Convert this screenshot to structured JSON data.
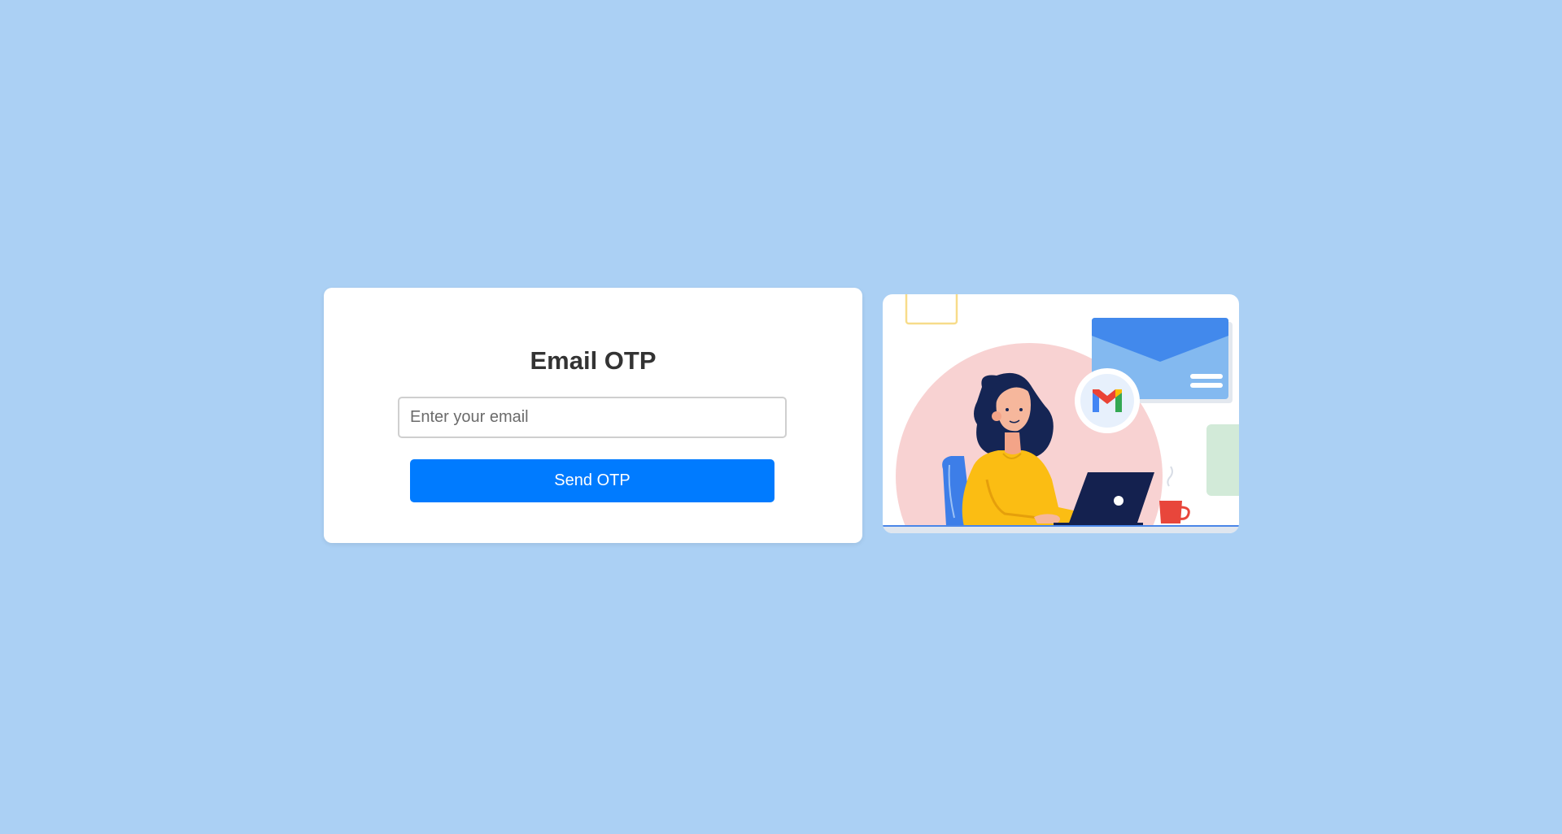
{
  "form": {
    "title": "Email OTP",
    "email_placeholder": "Enter your email",
    "email_value": "",
    "send_label": "Send OTP"
  },
  "colors": {
    "page_background": "#abd0f4",
    "card_background": "#ffffff",
    "title_color": "#333333",
    "button_background": "#007bff",
    "button_text": "#ffffff",
    "input_border": "#cfcfcf"
  },
  "illustration": {
    "icon": "gmail-logo",
    "scene": "person-at-laptop-with-envelope"
  }
}
